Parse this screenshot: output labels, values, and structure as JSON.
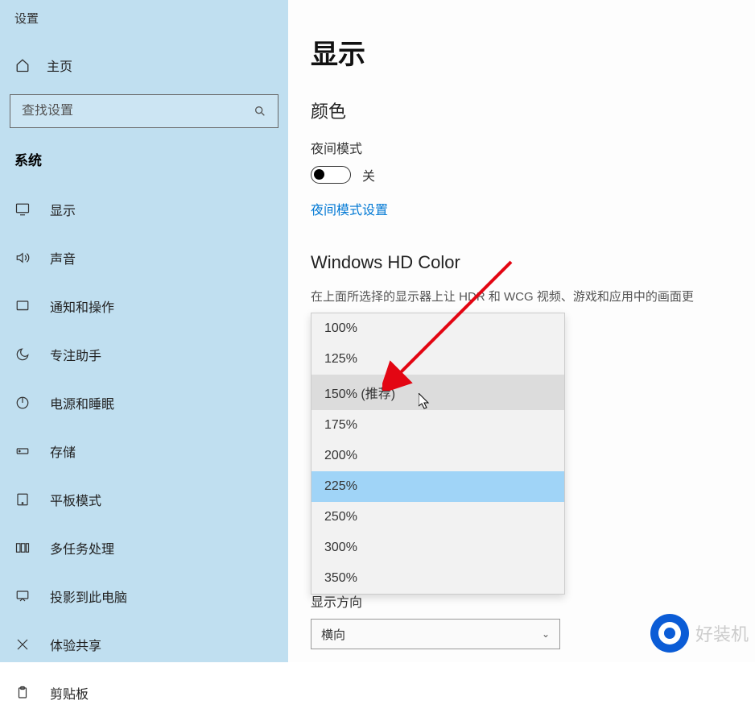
{
  "sidebar": {
    "app_title": "设置",
    "home_label": "主页",
    "search_placeholder": "查找设置",
    "category": "系统",
    "items": [
      {
        "label": "显示",
        "icon": "monitor-icon"
      },
      {
        "label": "声音",
        "icon": "speaker-icon"
      },
      {
        "label": "通知和操作",
        "icon": "notification-icon"
      },
      {
        "label": "专注助手",
        "icon": "moon-icon"
      },
      {
        "label": "电源和睡眠",
        "icon": "power-icon"
      },
      {
        "label": "存储",
        "icon": "storage-icon"
      },
      {
        "label": "平板模式",
        "icon": "tablet-icon"
      },
      {
        "label": "多任务处理",
        "icon": "multitask-icon"
      },
      {
        "label": "投影到此电脑",
        "icon": "project-icon"
      },
      {
        "label": "体验共享",
        "icon": "share-icon"
      },
      {
        "label": "剪贴板",
        "icon": "clipboard-icon"
      }
    ]
  },
  "main": {
    "title": "显示",
    "color_heading": "颜色",
    "night_light_label": "夜间模式",
    "toggle_state": "关",
    "night_light_link": "夜间模式设置",
    "hd_heading": "Windows HD Color",
    "hd_desc": "在上面所选择的显示器上让 HDR 和 WCG 视频、游戏和应用中的画面更",
    "orientation_label": "显示方向",
    "orientation_value": "横向"
  },
  "dropdown": {
    "options": [
      "100%",
      "125%",
      "150% (推荐)",
      "175%",
      "200%",
      "225%",
      "250%",
      "300%",
      "350%"
    ],
    "hover_index": 2,
    "selected_index": 5
  },
  "watermark": {
    "text": "好装机"
  }
}
